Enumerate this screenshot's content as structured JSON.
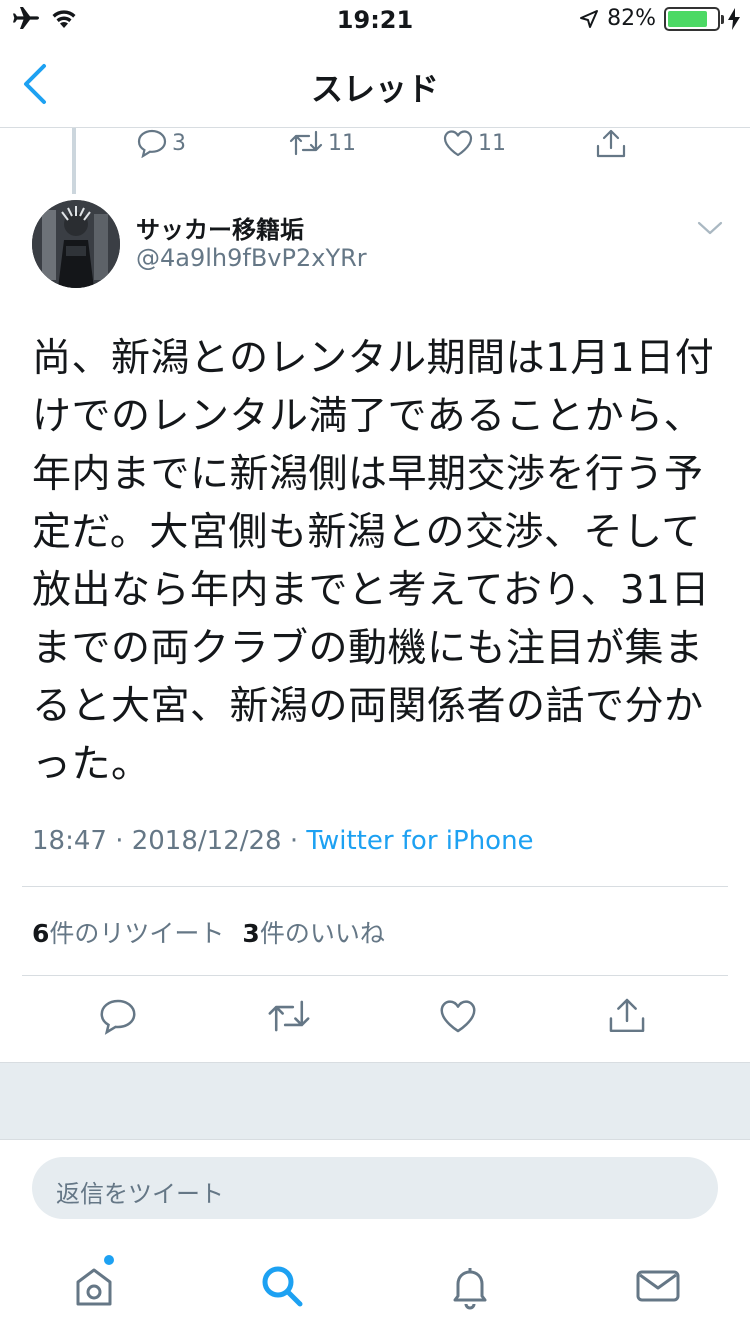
{
  "status_bar": {
    "time": "19:21",
    "battery_percent_text": "82%",
    "battery_level": 0.82,
    "icons": [
      "airplane-icon",
      "wifi-icon",
      "location-icon",
      "battery-icon",
      "charging-icon"
    ]
  },
  "nav": {
    "title": "スレッド",
    "back_icon": "chevron-left-icon"
  },
  "previous_tweet": {
    "reply_count": "3",
    "retweet_count": "11",
    "like_count": "11"
  },
  "tweet": {
    "author_name": "サッカー移籍垢",
    "author_handle": "@4a9lh9fBvP2xYRr",
    "lines": [
      "尚、新潟とのレンタル期間は1月1日付",
      "けでのレンタル満了であることから、",
      "年内までに新潟側は早期交渉を行う予",
      "定だ。大宮側も新潟との交渉、そして",
      "放出なら年内までと考えており、31日",
      "までの両クラブの動機にも注目が集ま",
      "ると大宮、新潟の両関係者の話で分か",
      "った。"
    ],
    "timestamp": "18:47 · 2018/12/28 · ",
    "source": "Twitter for iPhone",
    "retweets_count": "6",
    "retweets_label": "件のリツイート",
    "likes_count": "3",
    "likes_label": "件のいいね"
  },
  "reply": {
    "placeholder": "返信をツイート"
  },
  "tabbar": {
    "items": [
      "home-icon",
      "search-icon",
      "notifications-icon",
      "messages-icon"
    ]
  },
  "colors": {
    "accent": "#1da1f2",
    "secondary_text": "#657786",
    "divider": "#d8dde1",
    "battery_fill": "#4cd964"
  }
}
